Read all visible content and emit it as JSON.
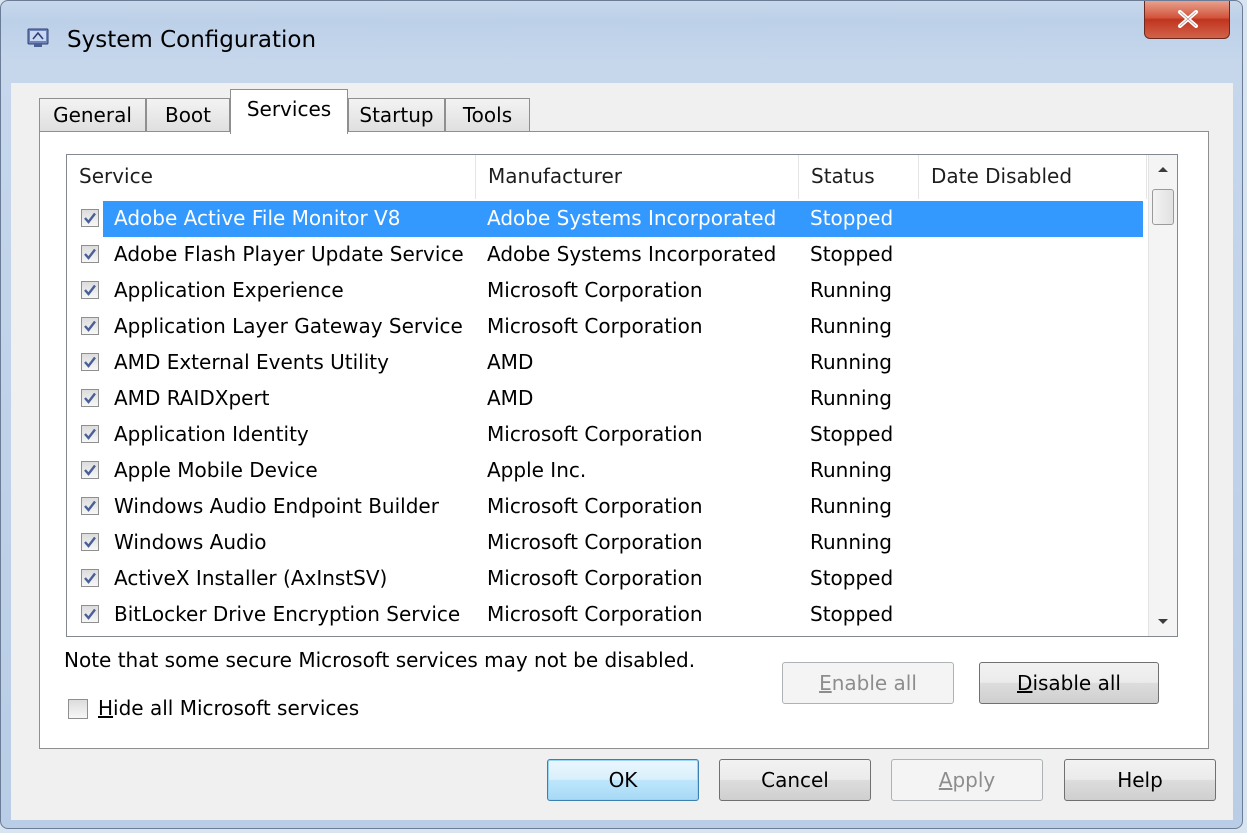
{
  "window": {
    "title": "System Configuration"
  },
  "tabs": [
    {
      "label": "General",
      "active": false
    },
    {
      "label": "Boot",
      "active": false
    },
    {
      "label": "Services",
      "active": true
    },
    {
      "label": "Startup",
      "active": false
    },
    {
      "label": "Tools",
      "active": false
    }
  ],
  "services_list": {
    "columns": [
      "Service",
      "Manufacturer",
      "Status",
      "Date Disabled"
    ],
    "rows": [
      {
        "service": "Adobe Active File Monitor V8",
        "manufacturer": "Adobe Systems Incorporated",
        "status": "Stopped",
        "date_disabled": "",
        "checked": true,
        "selected": true
      },
      {
        "service": "Adobe Flash Player Update Service",
        "manufacturer": "Adobe Systems Incorporated",
        "status": "Stopped",
        "date_disabled": "",
        "checked": true,
        "selected": false
      },
      {
        "service": "Application Experience",
        "manufacturer": "Microsoft Corporation",
        "status": "Running",
        "date_disabled": "",
        "checked": true,
        "selected": false
      },
      {
        "service": "Application Layer Gateway Service",
        "manufacturer": "Microsoft Corporation",
        "status": "Running",
        "date_disabled": "",
        "checked": true,
        "selected": false
      },
      {
        "service": "AMD External Events Utility",
        "manufacturer": "AMD",
        "status": "Running",
        "date_disabled": "",
        "checked": true,
        "selected": false
      },
      {
        "service": "AMD RAIDXpert",
        "manufacturer": "AMD",
        "status": "Running",
        "date_disabled": "",
        "checked": true,
        "selected": false
      },
      {
        "service": "Application Identity",
        "manufacturer": "Microsoft Corporation",
        "status": "Stopped",
        "date_disabled": "",
        "checked": true,
        "selected": false
      },
      {
        "service": "Apple Mobile Device",
        "manufacturer": "Apple Inc.",
        "status": "Running",
        "date_disabled": "",
        "checked": true,
        "selected": false
      },
      {
        "service": "Windows Audio Endpoint Builder",
        "manufacturer": "Microsoft Corporation",
        "status": "Running",
        "date_disabled": "",
        "checked": true,
        "selected": false
      },
      {
        "service": "Windows Audio",
        "manufacturer": "Microsoft Corporation",
        "status": "Running",
        "date_disabled": "",
        "checked": true,
        "selected": false
      },
      {
        "service": "ActiveX Installer (AxInstSV)",
        "manufacturer": "Microsoft Corporation",
        "status": "Stopped",
        "date_disabled": "",
        "checked": true,
        "selected": false
      },
      {
        "service": "BitLocker Drive Encryption Service",
        "manufacturer": "Microsoft Corporation",
        "status": "Stopped",
        "date_disabled": "",
        "checked": true,
        "selected": false
      }
    ]
  },
  "note": "Note that some secure Microsoft services may not be disabled.",
  "buttons": {
    "enable_all": {
      "pre": "",
      "key": "E",
      "post": "nable all",
      "enabled": false
    },
    "disable_all": {
      "pre": "",
      "key": "D",
      "post": "isable all",
      "enabled": true
    },
    "ok": {
      "label": "OK"
    },
    "cancel": {
      "label": "Cancel"
    },
    "apply": {
      "pre": "",
      "key": "A",
      "post": "pply",
      "enabled": false
    },
    "help": {
      "label": "Help"
    }
  },
  "hide_ms": {
    "pre": "",
    "key": "H",
    "post": "ide all Microsoft services",
    "checked": false
  },
  "colors": {
    "selection": "#3399ff",
    "client_bg": "#f0f0f0",
    "close_red": "#c0341e"
  },
  "icons": [
    "system-config-icon",
    "close-icon",
    "checkmark-icon",
    "scroll-up-arrow-icon",
    "scroll-down-arrow-icon"
  ]
}
